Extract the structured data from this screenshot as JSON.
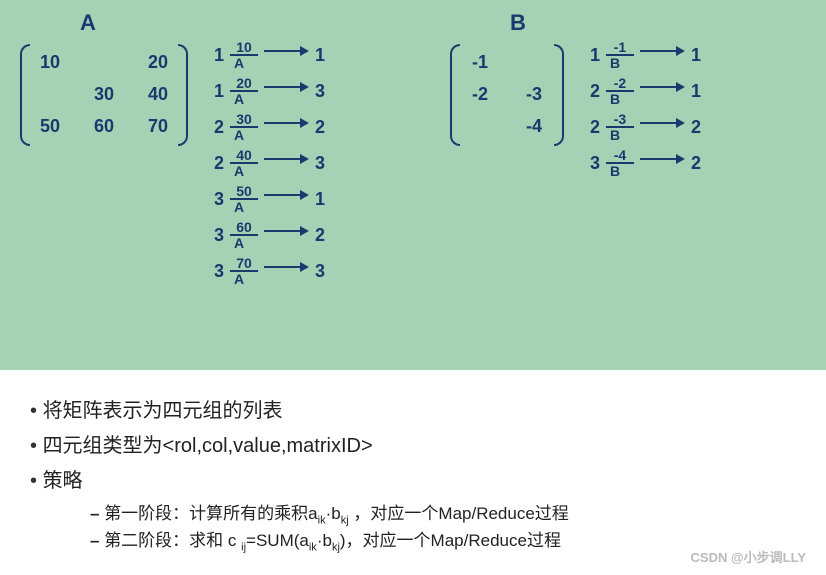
{
  "sections": {
    "A": {
      "title": "A",
      "matrix": [
        [
          "10",
          "",
          "20"
        ],
        [
          "",
          "30",
          "40"
        ],
        [
          "50",
          "60",
          "70"
        ]
      ],
      "transitions": [
        {
          "src": "1",
          "val": "10",
          "tag": "A",
          "dst": "1"
        },
        {
          "src": "1",
          "val": "20",
          "tag": "A",
          "dst": "3"
        },
        {
          "src": "2",
          "val": "30",
          "tag": "A",
          "dst": "2"
        },
        {
          "src": "2",
          "val": "40",
          "tag": "A",
          "dst": "3"
        },
        {
          "src": "3",
          "val": "50",
          "tag": "A",
          "dst": "1"
        },
        {
          "src": "3",
          "val": "60",
          "tag": "A",
          "dst": "2"
        },
        {
          "src": "3",
          "val": "70",
          "tag": "A",
          "dst": "3"
        }
      ]
    },
    "B": {
      "title": "B",
      "matrix": [
        [
          "-1",
          ""
        ],
        [
          "-2",
          "-3"
        ],
        [
          "",
          "-4"
        ]
      ],
      "transitions": [
        {
          "src": "1",
          "val": "-1",
          "tag": "B",
          "dst": "1"
        },
        {
          "src": "2",
          "val": "-2",
          "tag": "B",
          "dst": "1"
        },
        {
          "src": "2",
          "val": "-3",
          "tag": "B",
          "dst": "2"
        },
        {
          "src": "3",
          "val": "-4",
          "tag": "B",
          "dst": "2"
        }
      ]
    }
  },
  "notes": {
    "b1": "将矩阵表示为四元组的列表",
    "b2": "四元组类型为<rol,col,value,matrixID>",
    "b3": "策略",
    "s1_pre": "第一阶段：计算所有的乘积a",
    "s1_sub1": "ik",
    "s1_mid": "·b",
    "s1_sub2": "kj",
    "s1_post": " ，对应一个Map/Reduce过程",
    "s2_pre": "第二阶段：求和 c ",
    "s2_sub1": "ij",
    "s2_mid": "=SUM(a",
    "s2_sub2": "ik",
    "s2_mid2": "·b",
    "s2_sub3": "kj",
    "s2_post": ")，对应一个Map/Reduce过程"
  },
  "watermark": "CSDN @小步调LLY"
}
